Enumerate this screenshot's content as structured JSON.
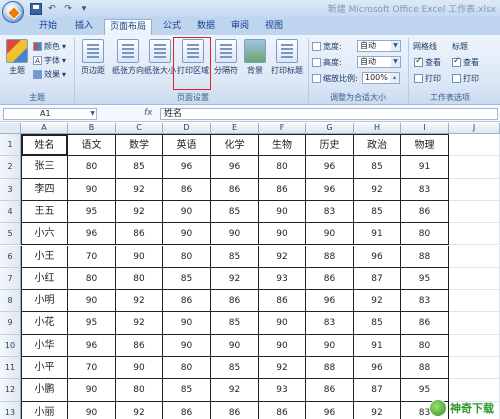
{
  "window": {
    "title": "新建 Microsoft Office Excel 工作表.xlsx",
    "qat": [
      "save-icon",
      "undo-icon",
      "redo-icon",
      "customize-icon"
    ]
  },
  "tabs": [
    {
      "label": "开始"
    },
    {
      "label": "插入"
    },
    {
      "label": "页面布局",
      "active": true
    },
    {
      "label": "公式"
    },
    {
      "label": "数据"
    },
    {
      "label": "审阅"
    },
    {
      "label": "视图"
    }
  ],
  "ribbon": {
    "theme": {
      "main": "主题",
      "colors": "颜色",
      "fonts": "字体",
      "effects": "效果",
      "group": "主题"
    },
    "page_setup": {
      "margins": "页边距",
      "orientation": "纸张方向",
      "size": "纸张大小",
      "print_area": "打印区域",
      "breaks": "分隔符",
      "background": "背景",
      "print_titles": "打印标题",
      "group": "页面设置"
    },
    "scale": {
      "width_label": "宽度:",
      "width_value": "自动",
      "height_label": "高度:",
      "height_value": "自动",
      "scale_label": "缩放比例:",
      "scale_value": "100%",
      "group": "调整为合适大小"
    },
    "sheet_options": {
      "gridlines": "网格线",
      "headings": "标题",
      "view1": "查看",
      "print1": "打印",
      "view2": "查看",
      "print2": "打印",
      "group": "工作表选项"
    }
  },
  "formula_bar": {
    "name_box": "A1",
    "fx": "fx",
    "value": "姓名"
  },
  "grid": {
    "columns": [
      "A",
      "B",
      "C",
      "D",
      "E",
      "F",
      "G",
      "H",
      "I",
      "J"
    ],
    "header": [
      "姓名",
      "语文",
      "数学",
      "英语",
      "化学",
      "生物",
      "历史",
      "政治",
      "物理"
    ],
    "rows": [
      [
        "张三",
        "80",
        "85",
        "96",
        "96",
        "80",
        "96",
        "85",
        "91"
      ],
      [
        "李四",
        "90",
        "92",
        "86",
        "86",
        "86",
        "96",
        "92",
        "83"
      ],
      [
        "王五",
        "95",
        "92",
        "90",
        "85",
        "90",
        "83",
        "85",
        "86"
      ],
      [
        "小六",
        "96",
        "86",
        "90",
        "90",
        "90",
        "90",
        "91",
        "80"
      ],
      [
        "小王",
        "70",
        "90",
        "80",
        "85",
        "92",
        "88",
        "96",
        "88"
      ],
      [
        "小红",
        "80",
        "80",
        "85",
        "92",
        "93",
        "86",
        "87",
        "95"
      ],
      [
        "小明",
        "90",
        "92",
        "86",
        "86",
        "86",
        "96",
        "92",
        "83"
      ],
      [
        "小花",
        "95",
        "92",
        "90",
        "85",
        "90",
        "83",
        "85",
        "86"
      ],
      [
        "小华",
        "96",
        "86",
        "90",
        "90",
        "90",
        "90",
        "91",
        "80"
      ],
      [
        "小平",
        "70",
        "90",
        "80",
        "85",
        "92",
        "88",
        "96",
        "88"
      ],
      [
        "小鹏",
        "90",
        "80",
        "85",
        "92",
        "93",
        "86",
        "87",
        "95"
      ],
      [
        "小丽",
        "90",
        "92",
        "86",
        "86",
        "86",
        "96",
        "92",
        "83"
      ]
    ],
    "row_numbers": [
      "1",
      "2",
      "3",
      "4",
      "5",
      "6",
      "7",
      "8",
      "9",
      "10",
      "11",
      "12",
      "13"
    ]
  },
  "watermark": {
    "text": "神奇下载"
  }
}
